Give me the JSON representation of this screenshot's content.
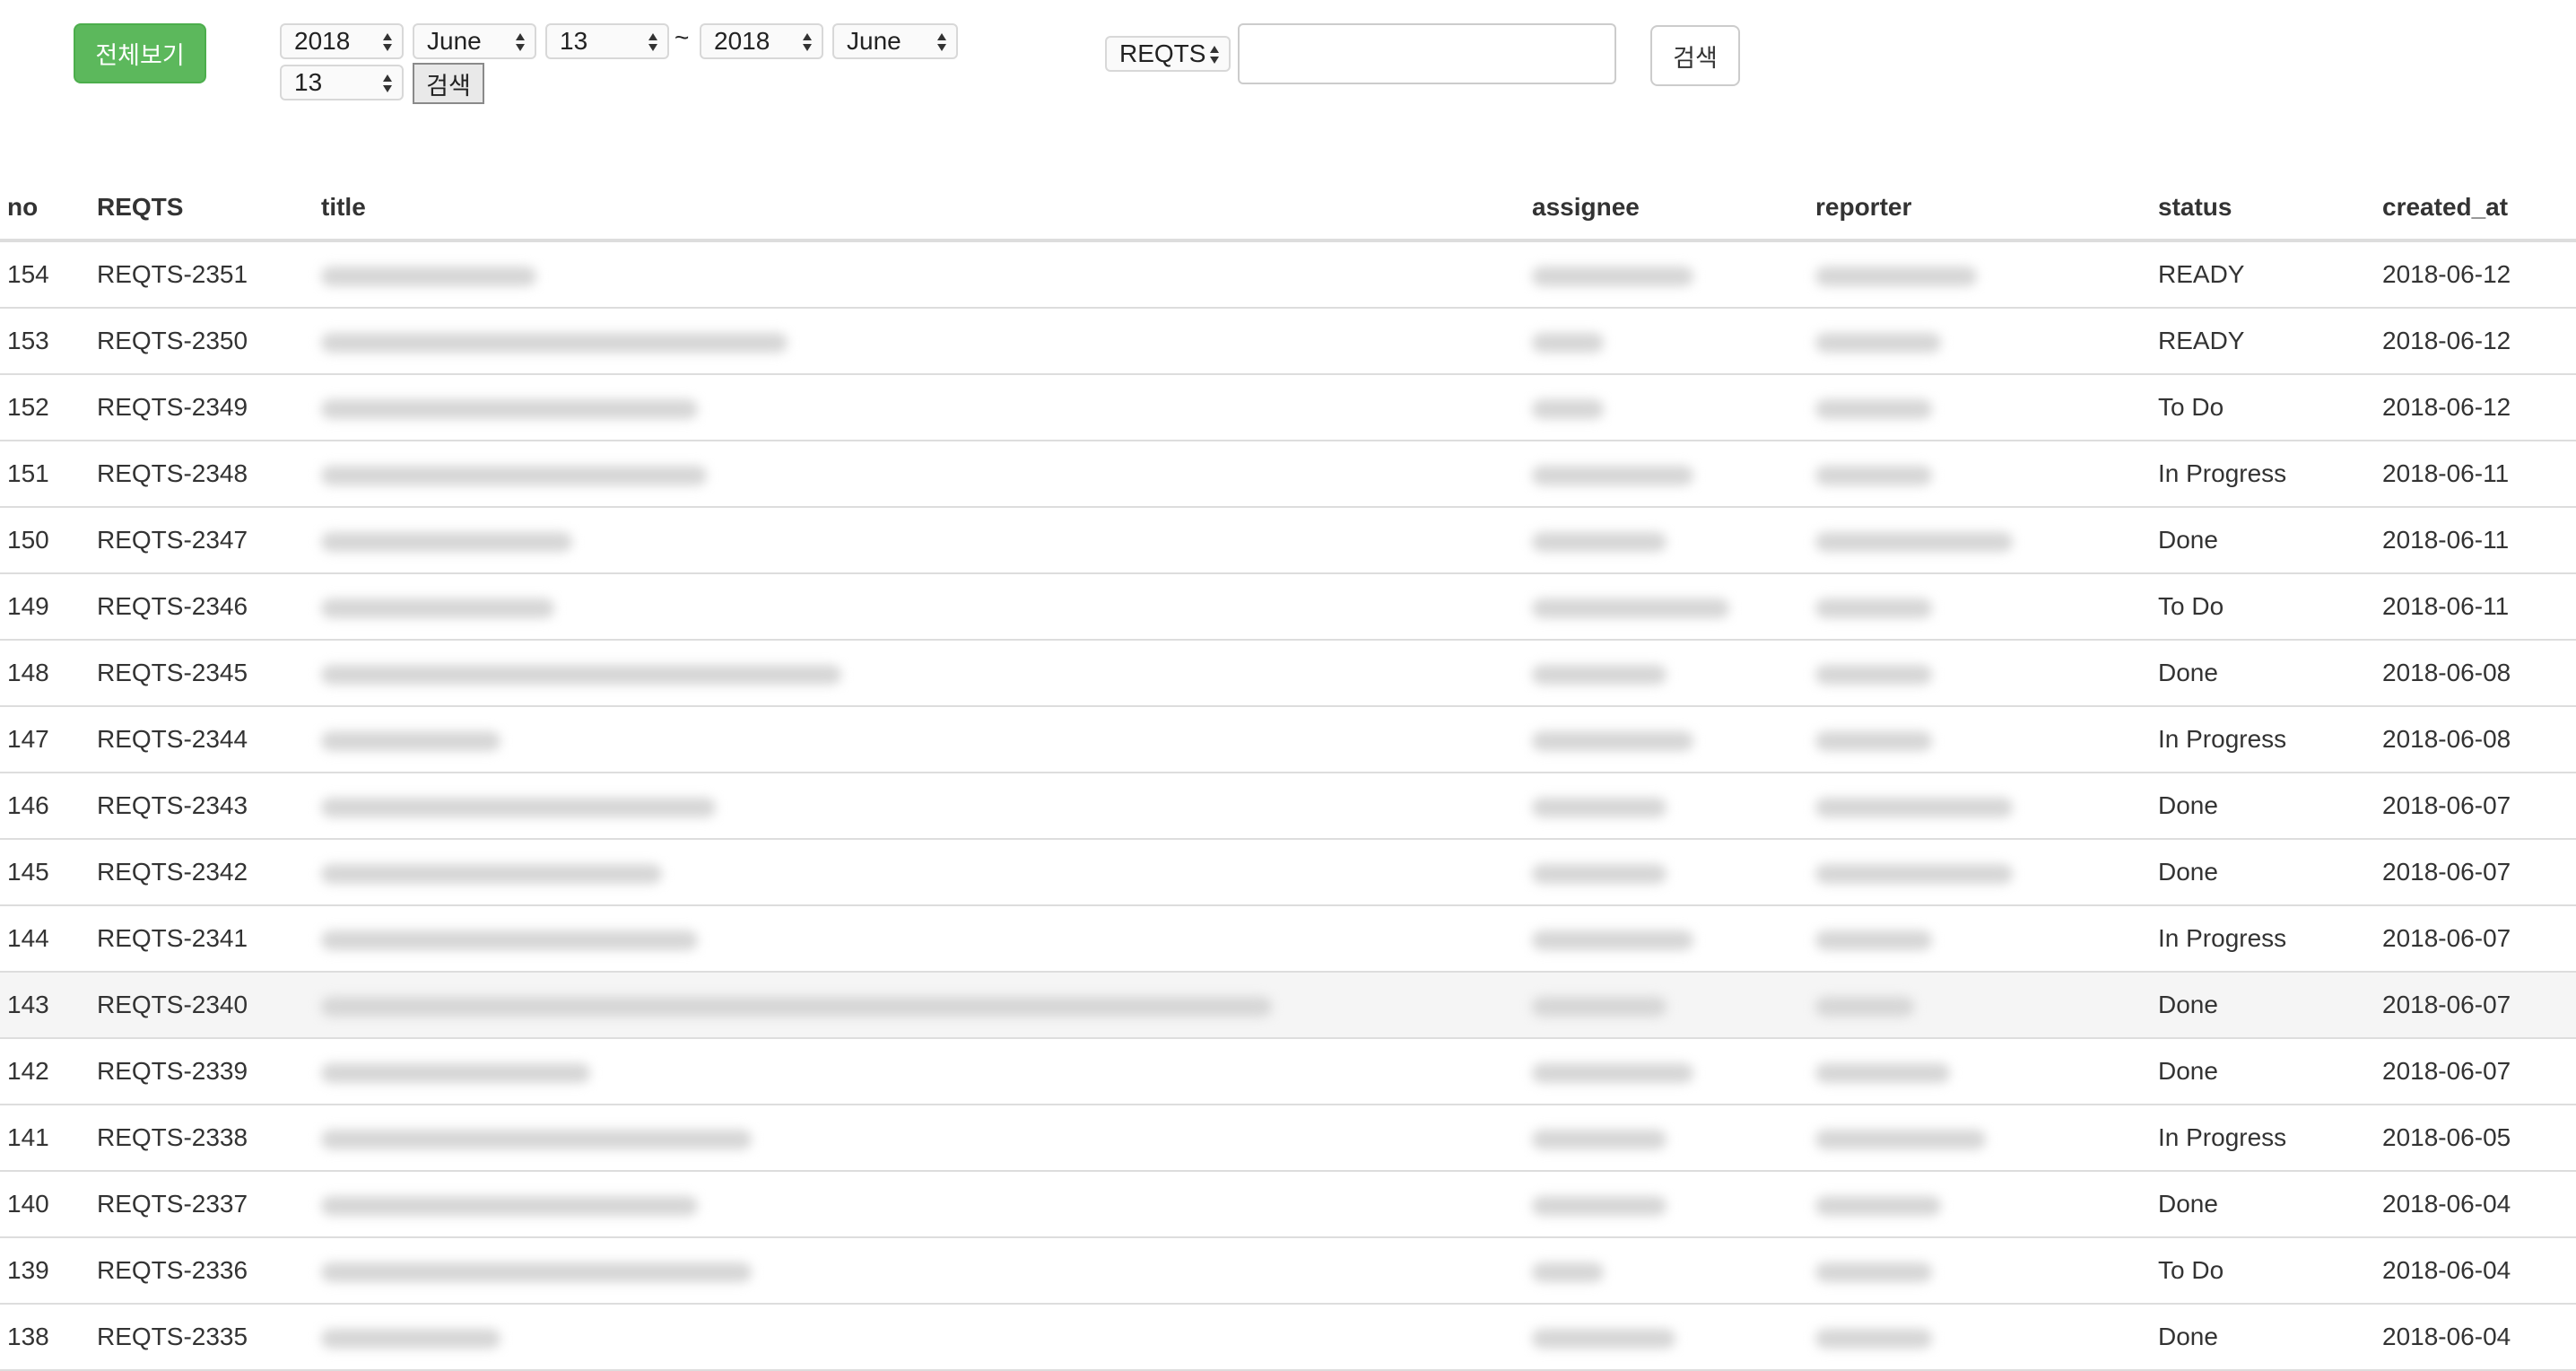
{
  "toolbar": {
    "show_all_label": "전체보기",
    "from": {
      "year": "2018",
      "month": "June",
      "day": "13"
    },
    "separator": "~",
    "to": {
      "year": "2018",
      "month": "June",
      "day": "13"
    },
    "date_search_label": "검색",
    "project_select": "REQTS",
    "search_input_value": "",
    "search_label": "검색"
  },
  "table": {
    "headers": {
      "no": "no",
      "key": "REQTS",
      "title": "title",
      "assignee": "assignee",
      "reporter": "reporter",
      "status": "status",
      "created_at": "created_at"
    },
    "rows": [
      {
        "no": "154",
        "key": "REQTS-2351",
        "status": "READY",
        "created_at": "2018-06-12"
      },
      {
        "no": "153",
        "key": "REQTS-2350",
        "status": "READY",
        "created_at": "2018-06-12"
      },
      {
        "no": "152",
        "key": "REQTS-2349",
        "status": "To Do",
        "created_at": "2018-06-12"
      },
      {
        "no": "151",
        "key": "REQTS-2348",
        "status": "In Progress",
        "created_at": "2018-06-11"
      },
      {
        "no": "150",
        "key": "REQTS-2347",
        "status": "Done",
        "created_at": "2018-06-11"
      },
      {
        "no": "149",
        "key": "REQTS-2346",
        "status": "To Do",
        "created_at": "2018-06-11"
      },
      {
        "no": "148",
        "key": "REQTS-2345",
        "status": "Done",
        "created_at": "2018-06-08"
      },
      {
        "no": "147",
        "key": "REQTS-2344",
        "status": "In Progress",
        "created_at": "2018-06-08"
      },
      {
        "no": "146",
        "key": "REQTS-2343",
        "status": "Done",
        "created_at": "2018-06-07"
      },
      {
        "no": "145",
        "key": "REQTS-2342",
        "status": "Done",
        "created_at": "2018-06-07"
      },
      {
        "no": "144",
        "key": "REQTS-2341",
        "status": "In Progress",
        "created_at": "2018-06-07"
      },
      {
        "no": "143",
        "key": "REQTS-2340",
        "status": "Done",
        "created_at": "2018-06-07"
      },
      {
        "no": "142",
        "key": "REQTS-2339",
        "status": "Done",
        "created_at": "2018-06-07"
      },
      {
        "no": "141",
        "key": "REQTS-2338",
        "status": "In Progress",
        "created_at": "2018-06-05"
      },
      {
        "no": "140",
        "key": "REQTS-2337",
        "status": "Done",
        "created_at": "2018-06-04"
      },
      {
        "no": "139",
        "key": "REQTS-2336",
        "status": "To Do",
        "created_at": "2018-06-04"
      },
      {
        "no": "138",
        "key": "REQTS-2335",
        "status": "Done",
        "created_at": "2018-06-04"
      }
    ]
  }
}
